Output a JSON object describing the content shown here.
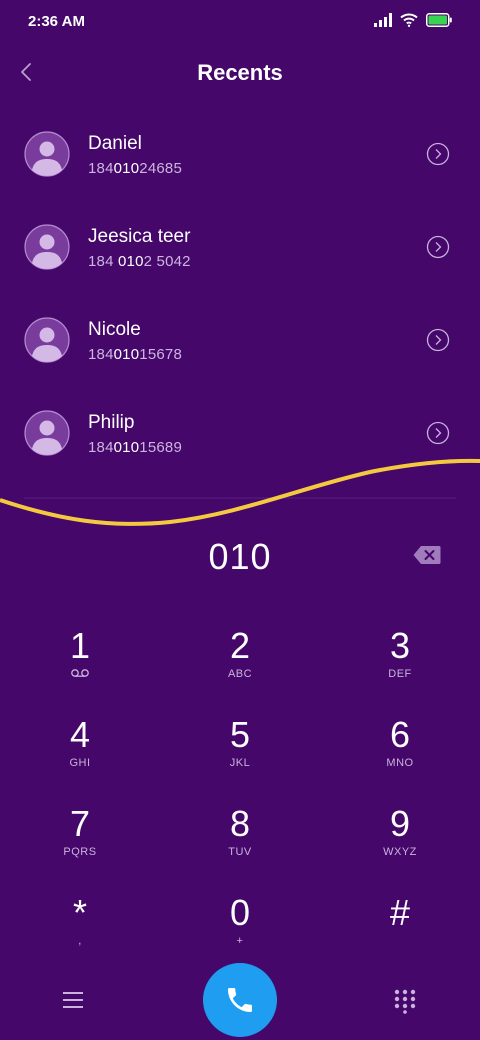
{
  "status_bar": {
    "time": "2:36 AM"
  },
  "header": {
    "title": "Recents"
  },
  "recents": [
    {
      "name": "Daniel",
      "number_parts": [
        "184",
        "010",
        "24685"
      ]
    },
    {
      "name": "Jeesica teer",
      "number_parts": [
        "184 ",
        "010",
        "2 5042"
      ]
    },
    {
      "name": "Nicole",
      "number_parts": [
        "184",
        "010",
        "15678"
      ]
    },
    {
      "name": "Philip",
      "number_parts": [
        "184",
        "010",
        "15689"
      ]
    }
  ],
  "dialer": {
    "entered_number": "010"
  },
  "keypad": {
    "keys": [
      {
        "digit": "1",
        "letters": ""
      },
      {
        "digit": "2",
        "letters": "ABC"
      },
      {
        "digit": "3",
        "letters": "DEF"
      },
      {
        "digit": "4",
        "letters": "GHI"
      },
      {
        "digit": "5",
        "letters": "JKL"
      },
      {
        "digit": "6",
        "letters": "MNO"
      },
      {
        "digit": "7",
        "letters": "PQRS"
      },
      {
        "digit": "8",
        "letters": "TUV"
      },
      {
        "digit": "9",
        "letters": "WXYZ"
      },
      {
        "digit": "*",
        "letters": ","
      },
      {
        "digit": "0",
        "letters": "+"
      },
      {
        "digit": "#",
        "letters": ""
      }
    ]
  },
  "colors": {
    "background": "#45076a",
    "wave": "#f5c93f",
    "call_button": "#1e9df1",
    "battery": "#39d353"
  },
  "icons": {
    "back": "chevron-left-icon",
    "detail": "chevron-right-circle-icon",
    "backspace": "backspace-icon",
    "voicemail": "voicemail-icon",
    "menu": "menu-icon",
    "call": "phone-icon",
    "keypad": "dialpad-icon"
  }
}
